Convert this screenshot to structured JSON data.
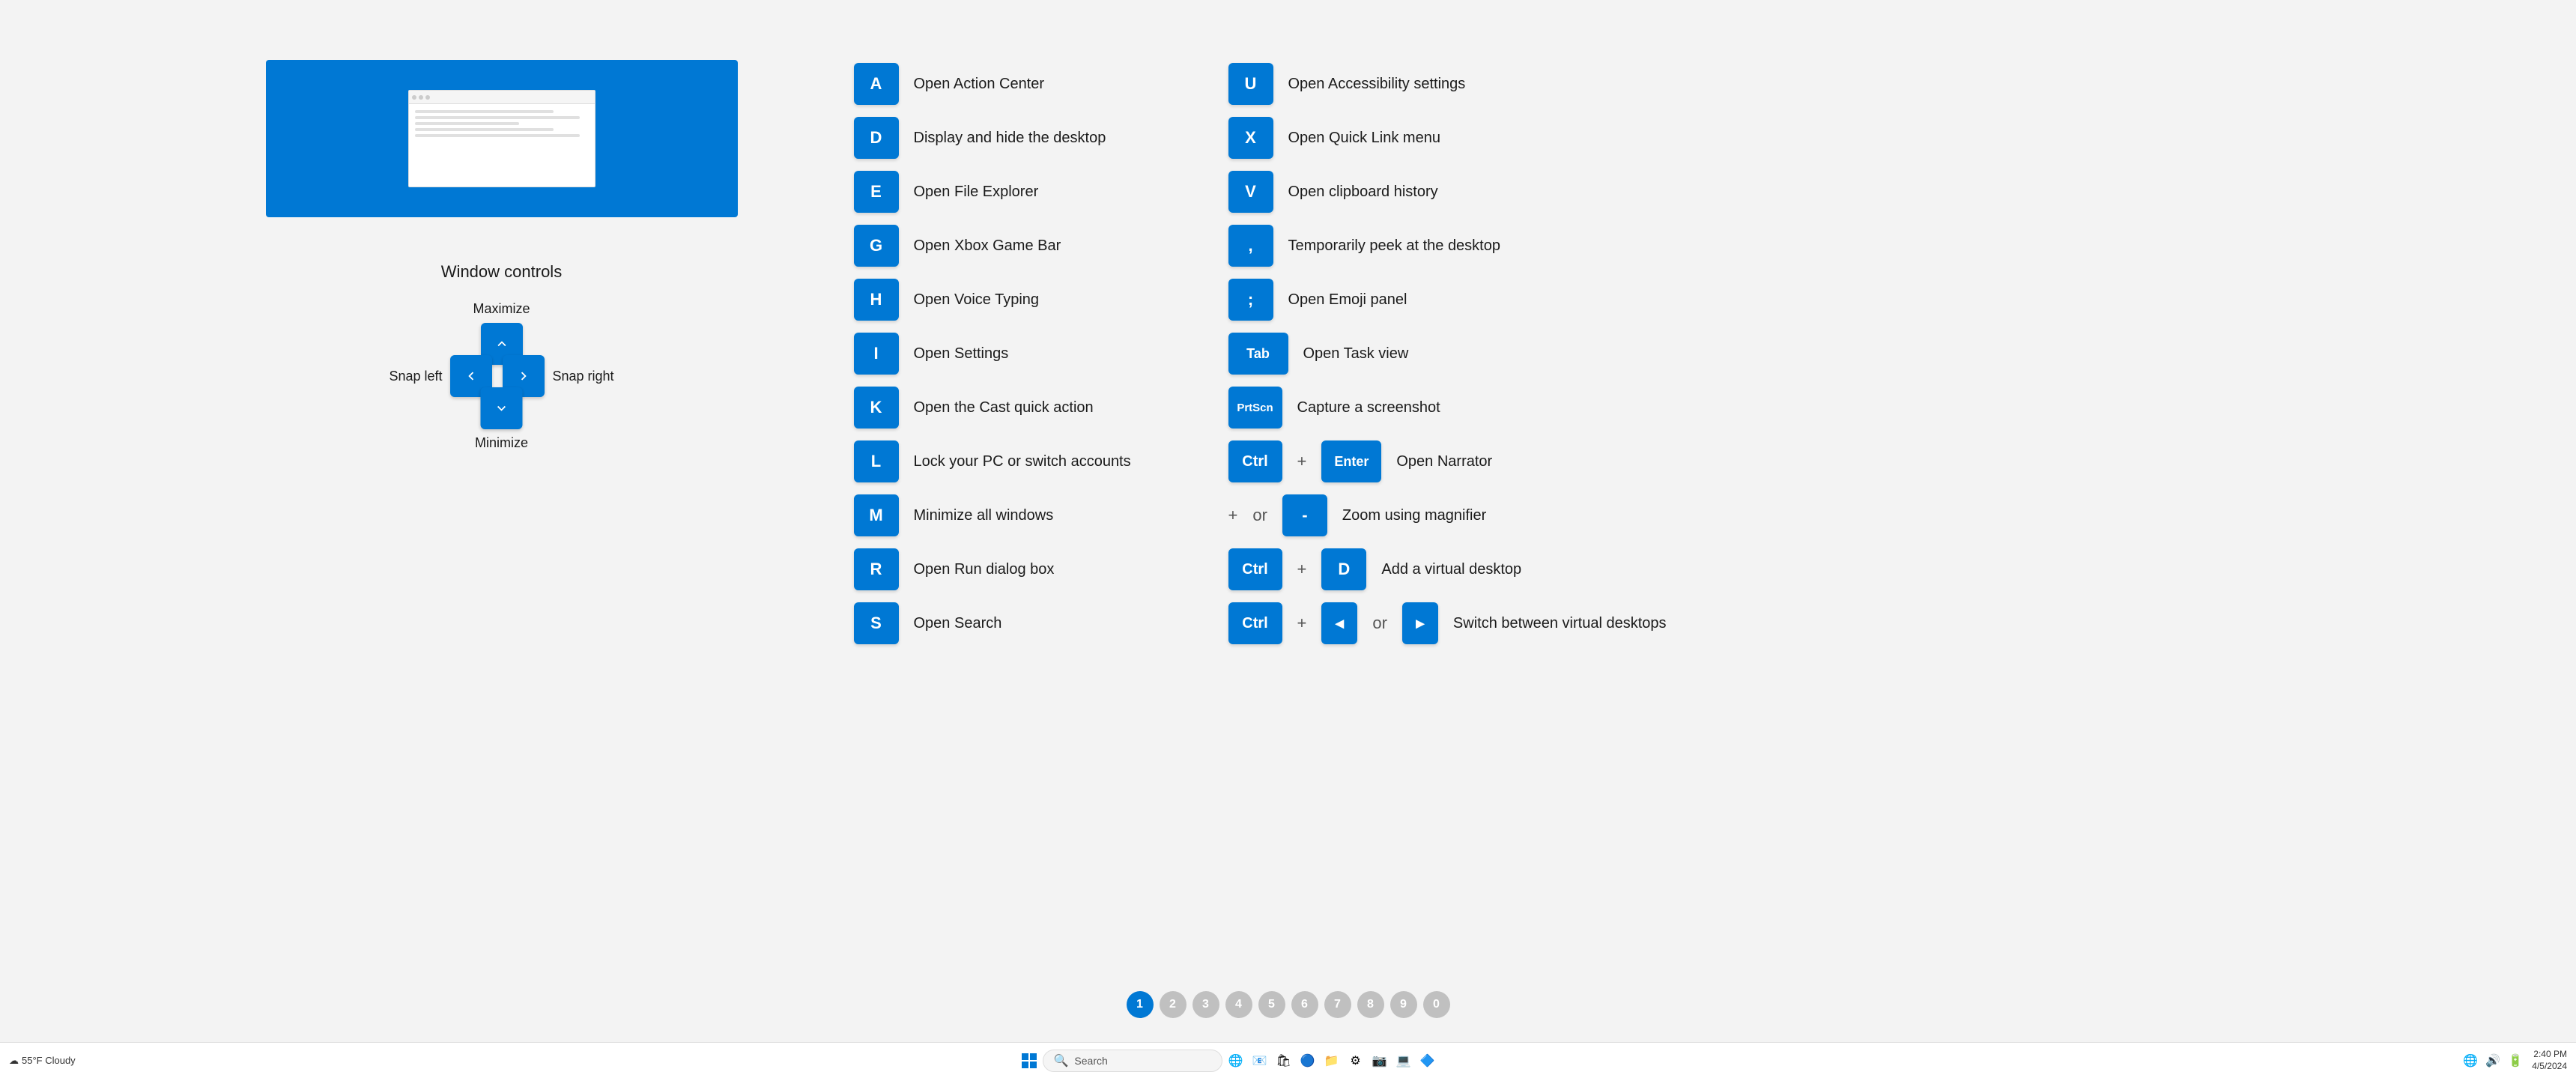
{
  "page": {
    "background": "#f3f3f3"
  },
  "window_controls": {
    "title": "Window controls",
    "maximize_label": "Maximize",
    "snap_left_label": "Snap left",
    "snap_right_label": "Snap right",
    "minimize_label": "Minimize"
  },
  "shortcuts_left": [
    {
      "key": "A",
      "desc": "Open Action Center"
    },
    {
      "key": "D",
      "desc": "Display and hide the desktop"
    },
    {
      "key": "E",
      "desc": "Open File Explorer"
    },
    {
      "key": "G",
      "desc": "Open Xbox Game Bar"
    },
    {
      "key": "H",
      "desc": "Open Voice Typing"
    },
    {
      "key": "I",
      "desc": "Open Settings"
    },
    {
      "key": "K",
      "desc": "Open the Cast quick action"
    },
    {
      "key": "L",
      "desc": "Lock your PC or switch accounts"
    },
    {
      "key": "M",
      "desc": "Minimize all windows"
    },
    {
      "key": "R",
      "desc": "Open Run dialog box"
    },
    {
      "key": "S",
      "desc": "Open Search"
    }
  ],
  "shortcuts_right": [
    {
      "key": "U",
      "desc": "Open Accessibility settings"
    },
    {
      "key": "X",
      "desc": "Open Quick Link menu"
    },
    {
      "key": "V",
      "desc": "Open clipboard history"
    },
    {
      "key": ",",
      "desc": "Temporarily peek at the desktop"
    },
    {
      "key": ";",
      "desc": "Open Emoji panel"
    },
    {
      "key": "Tab",
      "desc": "Open Task view",
      "wide": true
    },
    {
      "key": "PrtScn",
      "desc": "Capture a screenshot",
      "small": true
    },
    {
      "key": "ctrl_enter",
      "desc": "Open Narrator",
      "combo": [
        "Ctrl",
        "+",
        "Enter"
      ]
    },
    {
      "key": "plus_minus",
      "desc": "Zoom using magnifier",
      "combo": [
        "+",
        "or",
        "-"
      ]
    },
    {
      "key": "ctrl_d",
      "desc": "Add a virtual desktop",
      "combo": [
        "Ctrl",
        "+",
        "D"
      ]
    },
    {
      "key": "ctrl_arrows",
      "desc": "Switch between virtual desktops",
      "combo": [
        "Ctrl",
        "+",
        "◂",
        "or",
        "▸"
      ]
    }
  ],
  "pagination": {
    "pages": [
      "1",
      "2",
      "3",
      "4",
      "5",
      "6",
      "7",
      "8",
      "9",
      "0"
    ],
    "active": 0
  },
  "taskbar": {
    "weather": "55°F Cloudy",
    "search_placeholder": "Search",
    "time": "2:40 PM",
    "date": "4/5/2024"
  }
}
